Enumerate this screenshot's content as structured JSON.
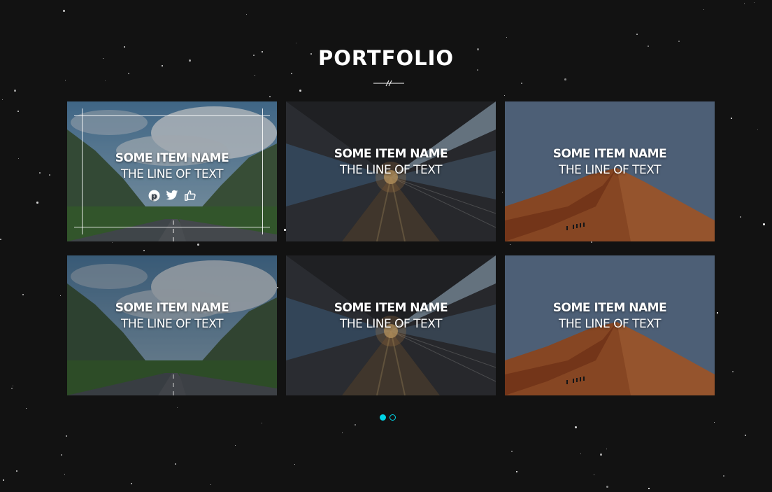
{
  "section": {
    "title": "PORTFOLIO"
  },
  "items": [
    {
      "name": "SOME ITEM NAME",
      "text": "THE LINE OF TEXT",
      "scene": "road"
    },
    {
      "name": "SOME ITEM NAME",
      "text": "THE LINE OF TEXT",
      "scene": "station"
    },
    {
      "name": "SOME ITEM NAME",
      "text": "THE LINE OF TEXT",
      "scene": "desert"
    },
    {
      "name": "SOME ITEM NAME",
      "text": "THE LINE OF TEXT",
      "scene": "road"
    },
    {
      "name": "SOME ITEM NAME",
      "text": "THE LINE OF TEXT",
      "scene": "station"
    },
    {
      "name": "SOME ITEM NAME",
      "text": "THE LINE OF TEXT",
      "scene": "desert"
    }
  ],
  "social_icons": [
    "pinterest-icon",
    "twitter-icon",
    "thumbs-up-icon"
  ],
  "pagination": {
    "pages": 2,
    "current": 1
  },
  "colors": {
    "background": "#121212",
    "accent": "#00d4e6",
    "text": "#ffffff"
  }
}
